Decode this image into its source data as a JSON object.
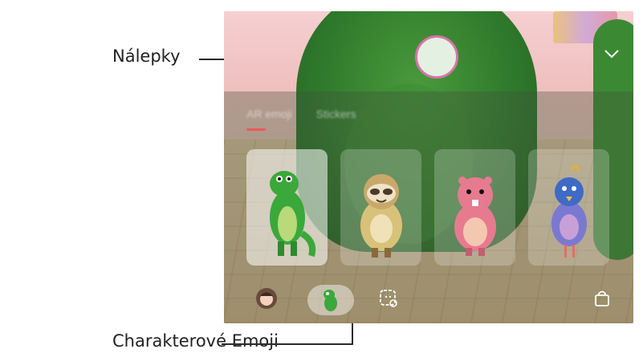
{
  "callouts": {
    "stickers": "Nálepky",
    "character_emoji": "Charakterové Emoji"
  },
  "tabs": [
    {
      "label": "AR emoji"
    },
    {
      "label": "Stickers"
    }
  ],
  "icons": {
    "shutter": "shutter-button",
    "collapse": "chevron-down-icon",
    "avatar": "my-emoji-avatar-icon",
    "emoji": "dino-emoji-icon",
    "sticker_settings": "sticker-settings-icon",
    "store": "shopping-bag-icon"
  },
  "characters": [
    {
      "name": "dino",
      "color": "#3aa83a"
    },
    {
      "name": "sloth",
      "color": "#d8c27a"
    },
    {
      "name": "beaver",
      "color": "#e87a90"
    },
    {
      "name": "bird",
      "color": "#7a79d0"
    }
  ],
  "colors": {
    "shutter_ring": "#d874a8",
    "tab_indicator": "#e85a5a"
  }
}
